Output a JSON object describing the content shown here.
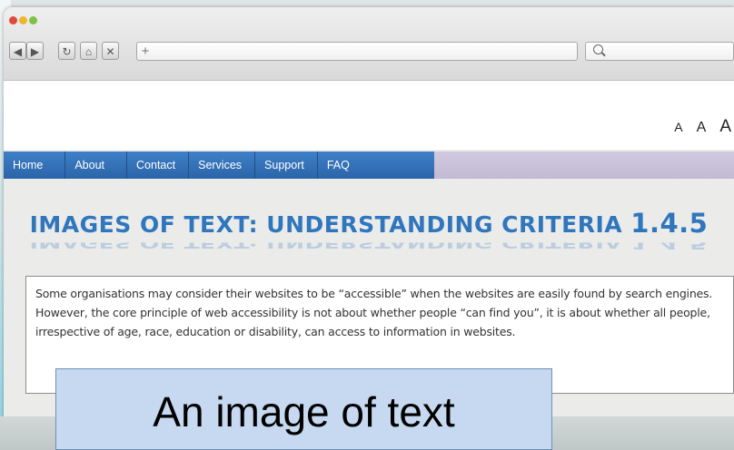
{
  "browser": {
    "nav_buttons": [
      {
        "name": "back-button",
        "glyph": "◀",
        "icon": "back-arrow-icon"
      },
      {
        "name": "forward-button",
        "glyph": "▶",
        "icon": "forward-arrow-icon"
      },
      {
        "name": "reload-button",
        "glyph": "↻",
        "icon": "reload-icon"
      },
      {
        "name": "home-button",
        "glyph": "⌂",
        "icon": "home-icon"
      },
      {
        "name": "stop-button",
        "glyph": "✕",
        "icon": "close-icon"
      }
    ],
    "new_tab_label": "+",
    "address_value": "",
    "search_value": ""
  },
  "text_size": {
    "small": "A",
    "medium": "A",
    "large": "A"
  },
  "menu": {
    "items": [
      "Home",
      "About",
      "Contact",
      "Services",
      "Support",
      "FAQ"
    ]
  },
  "main": {
    "title_prefix": "IMAGES OF TEXT: UNDERSTANDING CRITERIA ",
    "title_number": "1.4.5",
    "body": "Some organisations may consider their websites to be “accessible” when the websites are easily found by search engines. However, the core principle of web accessibility is not about whether people “can find you”, it is about whether all people, irrespective of age, race, education or disability, can access to information in websites."
  },
  "callout": {
    "text": "An image of text"
  },
  "colors": {
    "menu_blue": "#2f6db3",
    "title_blue": "#2f76bd",
    "callout_bg": "#c6d9f0"
  }
}
